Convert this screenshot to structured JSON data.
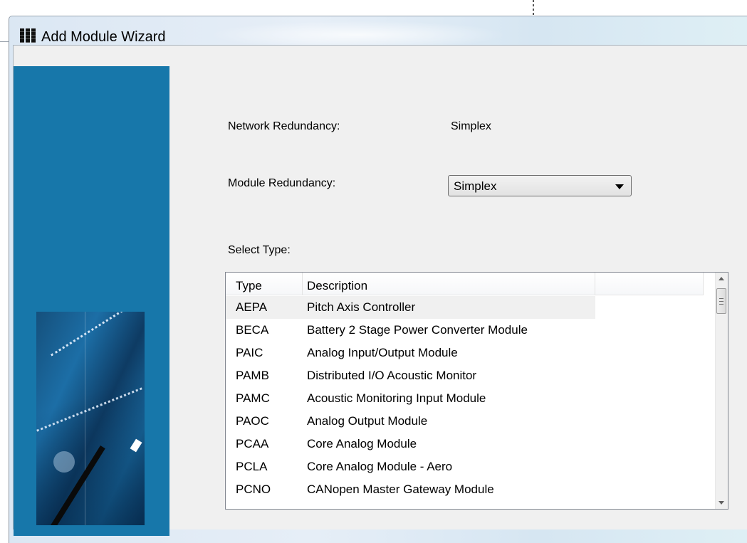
{
  "window": {
    "title": "Add Module Wizard"
  },
  "form": {
    "network_redundancy_label": "Network Redundancy:",
    "network_redundancy_value": "Simplex",
    "module_redundancy_label": "Module Redundancy:",
    "module_redundancy_value": "Simplex",
    "select_type_label": "Select Type:"
  },
  "list": {
    "columns": [
      "Type",
      "Description",
      ""
    ],
    "rows": [
      {
        "type": "AEPA",
        "description": "Pitch Axis Controller",
        "selected": true
      },
      {
        "type": "BECA",
        "description": "Battery 2 Stage Power Converter Module"
      },
      {
        "type": "PAIC",
        "description": "Analog Input/Output Module"
      },
      {
        "type": "PAMB",
        "description": "Distributed I/O Acoustic Monitor"
      },
      {
        "type": "PAMC",
        "description": "Acoustic Monitoring Input Module"
      },
      {
        "type": "PAOC",
        "description": "Analog Output Module"
      },
      {
        "type": "PCAA",
        "description": "Core Analog Module"
      },
      {
        "type": "PCLA",
        "description": "Core Analog Module - Aero"
      },
      {
        "type": "PCNO",
        "description": "CANopen Master Gateway Module"
      }
    ]
  },
  "colors": {
    "side_panel": "#1777aa",
    "selected_row": "#f0f0f0"
  }
}
